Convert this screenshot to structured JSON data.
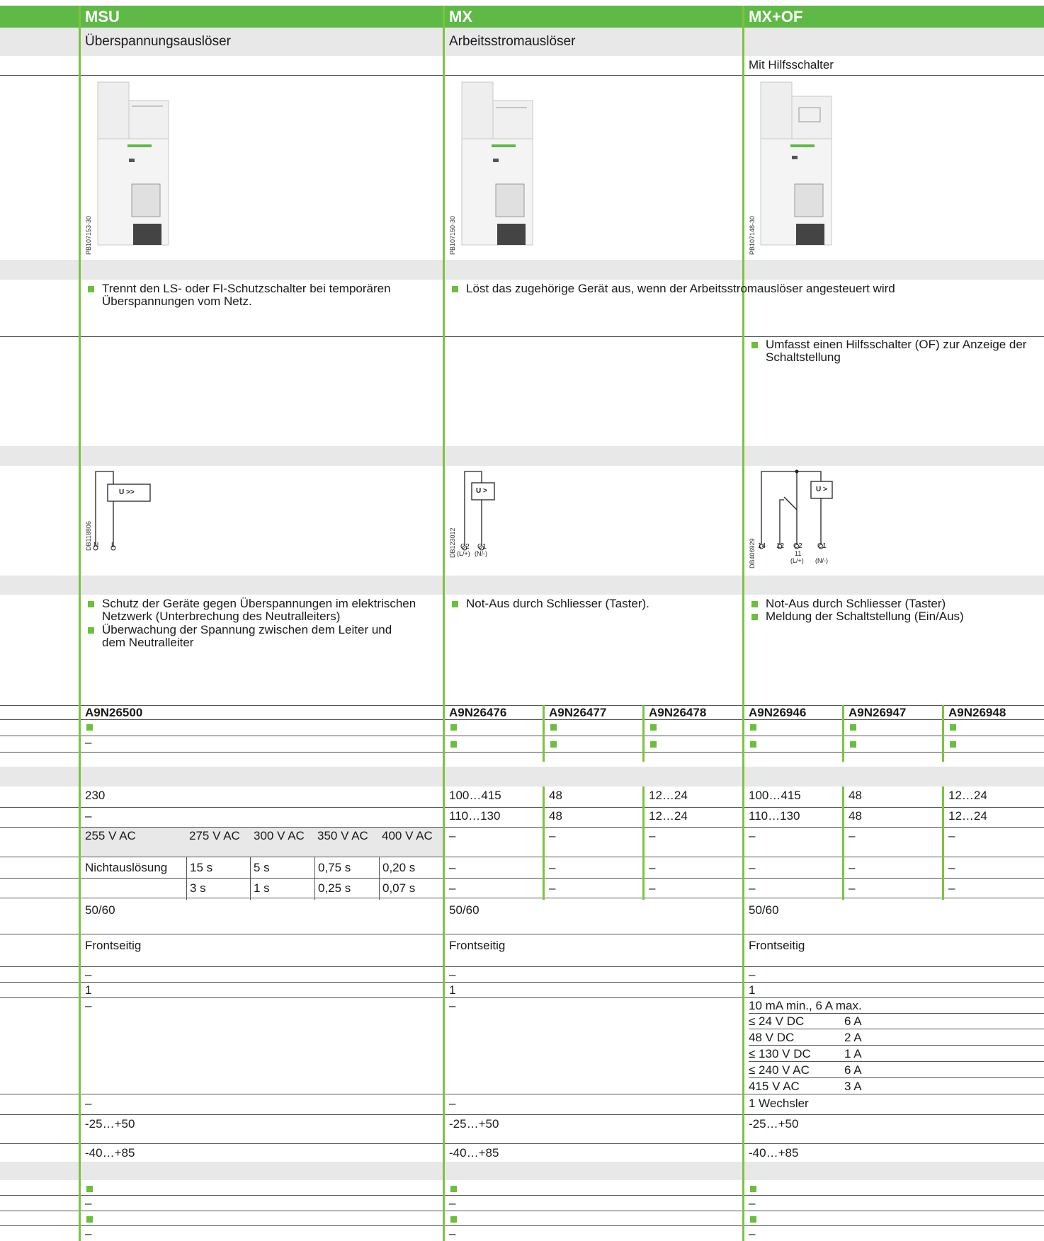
{
  "header": {
    "msu": "MSU",
    "mx": "MX",
    "mxof": "MX+OF"
  },
  "names": {
    "msu": "Überspannungsauslöser",
    "mx": "Arbeitsstromauslöser",
    "mxof_sub": "Mit Hilfsschalter"
  },
  "photo_codes": {
    "msu": "PB107153-30",
    "mx": "PB107150-30",
    "mxof": "PB107148-30"
  },
  "function": {
    "msu": "Trennt den LS- oder FI-Schutzschalter bei temporären Überspannungen vom Netz.",
    "mx": "Löst das zugehörige Gerät aus, wenn der Arbeitsstromauslöser angesteuert wird",
    "mxof": "Umfasst einen Hilfsschalter (OF) zur Anzeige der Schaltstellung"
  },
  "diagrams": {
    "msu": {
      "code": "DB118806",
      "box": "U >>",
      "t1": "N",
      "t2": "L"
    },
    "mx": {
      "code": "DB123012",
      "box": "U >",
      "t1": "C2",
      "t1b": "(L/+)",
      "t2": "C1",
      "t2b": "(N/-)"
    },
    "mxof": {
      "code": "DB406929",
      "box": "U >",
      "t1": "14",
      "t2": "12",
      "t3": "C2",
      "t3b": "11",
      "t3c": "(L/+)",
      "t4": "C1",
      "t4b": "(N/-)"
    }
  },
  "applications": {
    "msu": [
      "Schutz der Geräte gegen Überspannungen im elektrischen Netzwerk (Unterbrechung des Neutralleiters)",
      "Überwachung der Spannung zwischen dem Leiter und dem Neutralleiter"
    ],
    "mx": [
      "Not-Aus durch Schliesser (Taster)."
    ],
    "mxof": [
      "Not-Aus durch Schliesser (Taster)",
      "Meldung der Schaltstellung (Ein/Aus)"
    ]
  },
  "refs": [
    "A9N26500",
    "A9N26476",
    "A9N26477",
    "A9N26478",
    "A9N26946",
    "A9N26947",
    "A9N26948"
  ],
  "dash": "–",
  "voltage_ac": [
    "230",
    "100…415",
    "48",
    "12…24",
    "100…415",
    "48",
    "12…24"
  ],
  "voltage_dc": [
    "–",
    "110…130",
    "48",
    "12…24",
    "110…130",
    "48",
    "12…24"
  ],
  "msu_thresholds": [
    "255 V AC",
    "275 V AC",
    "300 V AC",
    "350 V AC",
    "400 V AC"
  ],
  "msu_times": {
    "label": "Nichtauslösung",
    "row1": [
      "15 s",
      "5 s",
      "0,75 s",
      "0,20 s"
    ],
    "row2": [
      "3 s",
      "1 s",
      "0,25 s",
      "0,07 s"
    ]
  },
  "frequency": "50/60",
  "indication": "Frontseitig",
  "width_value": "1",
  "contact_rating": {
    "head": "10 mA min., 6 A max.",
    "rows": [
      [
        "≤ 24 V DC",
        "6 A"
      ],
      [
        "48 V DC",
        "2 A"
      ],
      [
        "≤ 130 V DC",
        "1 A"
      ],
      [
        "≤ 240 V AC",
        "6 A"
      ],
      [
        "415 V AC",
        "3 A"
      ]
    ]
  },
  "contact_type": "1 Wechsler",
  "temp_operating": "-25…+50",
  "temp_storage": "-40…+85",
  "colors": {
    "green_header": "#5fb946",
    "green_line": "#7ec242",
    "gray_band": "#e8e8e8",
    "square": "#6cbf3c"
  }
}
